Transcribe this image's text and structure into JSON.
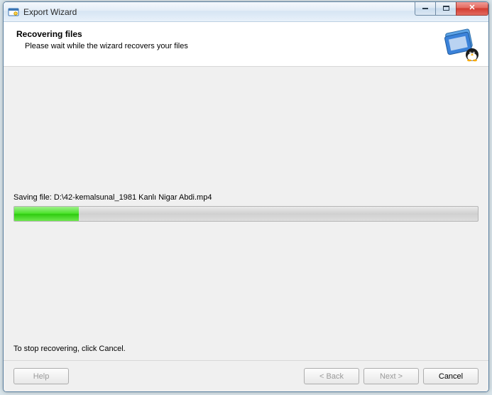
{
  "window": {
    "title": "Export Wizard"
  },
  "header": {
    "heading": "Recovering files",
    "subheading": "Please wait while the wizard recovers your files"
  },
  "content": {
    "status_prefix": "Saving file: ",
    "status_path": "D:\\42-kemalsunal_1981 Kanlı Nigar Abdi.mp4",
    "progress_percent": 14,
    "hint": "To stop recovering, click Cancel."
  },
  "footer": {
    "help": "Help",
    "back": "< Back",
    "next": "Next >",
    "cancel": "Cancel"
  },
  "icons": {
    "app": "app-icon",
    "header": "folder-penguin-icon",
    "minimize": "minimize-icon",
    "maximize": "maximize-icon",
    "close": "close-icon"
  },
  "colors": {
    "progress_fill": "#2ecc0f",
    "close_button": "#d23b30"
  }
}
